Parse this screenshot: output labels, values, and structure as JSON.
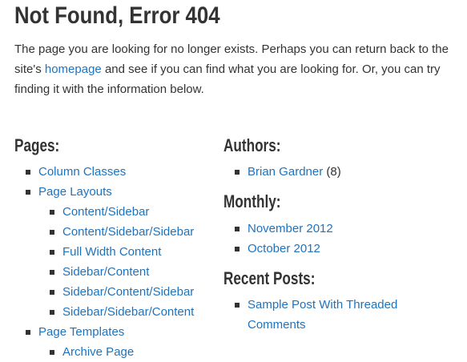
{
  "title": "Not Found, Error 404",
  "intro": {
    "before": "The page you are looking for no longer exists. Perhaps you can return back to the site's ",
    "link": "homepage",
    "after": " and see if you can find what you are looking for. Or, you can try finding it with the information below."
  },
  "pages": {
    "heading": "Pages:",
    "items": [
      {
        "label": "Column Classes"
      },
      {
        "label": "Page Layouts",
        "children": [
          "Content/Sidebar",
          "Content/Sidebar/Sidebar",
          "Full Width Content",
          "Sidebar/Content",
          "Sidebar/Content/Sidebar",
          "Sidebar/Sidebar/Content"
        ]
      },
      {
        "label": "Page Templates",
        "children": [
          "Archive Page"
        ]
      }
    ]
  },
  "authors": {
    "heading": "Authors:",
    "items": [
      {
        "label": "Brian Gardner",
        "count": "(8)"
      }
    ]
  },
  "monthly": {
    "heading": "Monthly:",
    "items": [
      "November 2012",
      "October 2012"
    ]
  },
  "recent_posts": {
    "heading": "Recent Posts:",
    "items": [
      "Sample Post With Threaded Comments"
    ]
  }
}
